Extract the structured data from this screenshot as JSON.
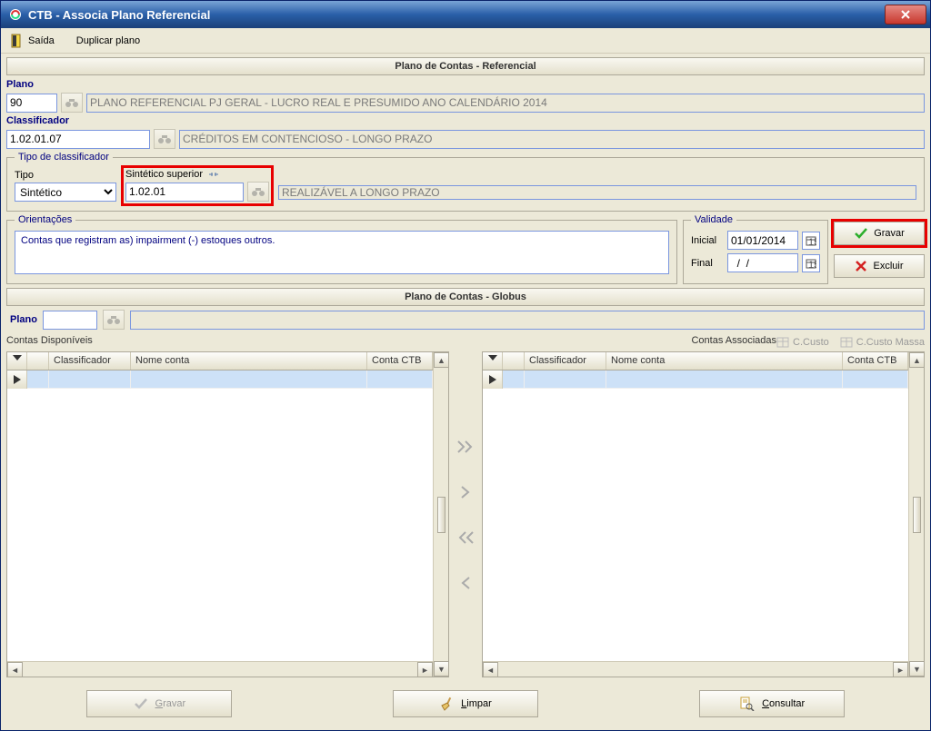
{
  "window": {
    "title": "CTB - Associa Plano Referencial"
  },
  "menu": {
    "saida": "Saída",
    "duplicar": "Duplicar plano"
  },
  "sections": {
    "referencial": "Plano de Contas - Referencial",
    "globus": "Plano de Contas - Globus"
  },
  "plano": {
    "label": "Plano",
    "value": "90",
    "desc": "PLANO REFERENCIAL PJ GERAL - LUCRO REAL E PRESUMIDO ANO CALENDÁRIO 2014"
  },
  "classificador": {
    "label": "Classificador",
    "value": "1.02.01.07",
    "desc": "CRÉDITOS EM CONTENCIOSO - LONGO PRAZO"
  },
  "tipoClass": {
    "legend": "Tipo de classificador",
    "tipoLabel": "Tipo",
    "tipoValue": "Sintético",
    "supLabel": "Sintético superior",
    "supValue": "1.02.01",
    "supDesc": "REALIZÁVEL A LONGO PRAZO"
  },
  "orient": {
    "legend": "Orientações",
    "text": "Contas que registram as) impairment (-) estoques outros."
  },
  "validade": {
    "legend": "Validade",
    "inicialLabel": "Inicial",
    "inicialValue": "01/01/2014",
    "finalLabel": "Final",
    "finalValue": "  /  /"
  },
  "buttons": {
    "gravar": "Gravar",
    "excluir": "Excluir",
    "limpar": "Limpar",
    "consultar": "Consultar",
    "gravarBottom": "Gravar"
  },
  "globus": {
    "planoLabel": "Plano",
    "planoValue": "",
    "disponiveis": "Contas Disponíveis",
    "associadas": "Contas Associadas",
    "ccusto": "C.Custo",
    "ccustoMassa": "C.Custo Massa",
    "cols": {
      "classificador": "Classificador",
      "nomeConta": "Nome conta",
      "contaCtb": "Conta CTB"
    }
  }
}
